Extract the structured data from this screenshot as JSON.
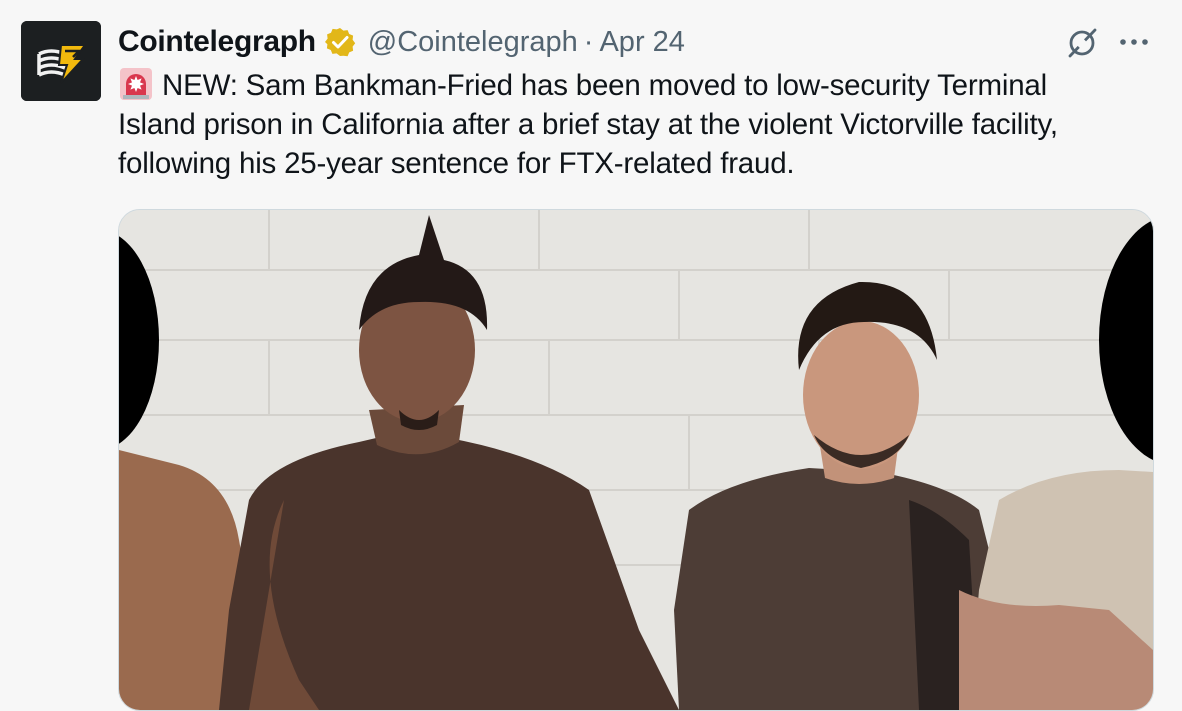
{
  "tweet": {
    "author_name": "Cointelegraph",
    "handle": "@Cointelegraph",
    "separator": "·",
    "date": "Apr 24",
    "text_lines": [
      "NEW: Sam Bankman-Fried has been moved to low-security Terminal",
      "Island prison in California after a brief stay at the violent Victorville facility,",
      "following his 25-year sentence for FTX-related fraud."
    ],
    "leading_emoji": "police-siren",
    "more_label": "···"
  },
  "icons": {
    "verified": "verified-badge-icon",
    "grok": "grok-icon",
    "more": "more-options-icon",
    "siren": "siren-icon"
  },
  "colors": {
    "badge_gold": "#e2b719",
    "secondary_text": "#536471",
    "avatar_bg": "#1c1f21",
    "brand_yellow": "#f2b90d"
  }
}
